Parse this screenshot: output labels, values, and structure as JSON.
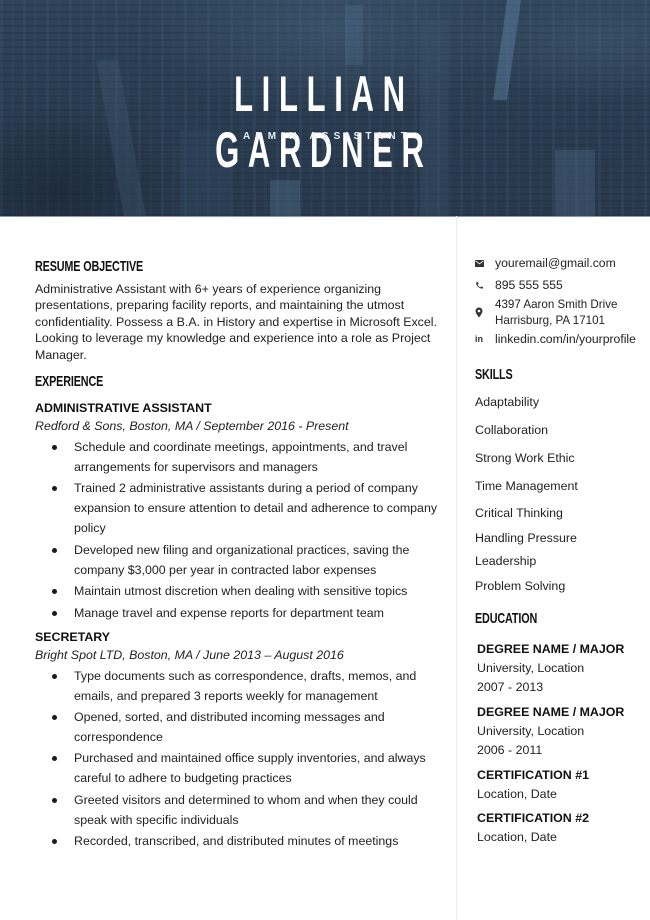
{
  "header": {
    "name": "LILLIAN GARDNER",
    "title": "ADMIN ASSISTANT",
    "background_color": "#2b3e53"
  },
  "objective": {
    "heading": "RESUME OBJECTIVE",
    "text": "Administrative Assistant with 6+ years of experience organizing presentations, preparing facility reports, and maintaining the utmost confidentiality.  Possess a B.A. in History and expertise in Microsoft Excel. Looking to leverage my knowledge and experience into a role as Project Manager."
  },
  "experience": {
    "heading": "EXPERIENCE",
    "jobs": [
      {
        "title": "ADMINISTRATIVE ASSISTANT",
        "meta": "Redford & Sons, Boston, MA  /  September 2016 - Present",
        "bullets": [
          "Schedule and coordinate meetings, appointments, and travel arrangements for supervisors and managers",
          "Trained 2 administrative assistants during a period of company expansion to ensure attention to detail and adherence to company policy",
          "Developed new filing and organizational practices, saving the company $3,000 per year in contracted labor expenses",
          "Maintain utmost discretion when dealing with sensitive topics",
          "Manage travel and expense reports for department team"
        ]
      },
      {
        "title": "SECRETARY",
        "meta": "Bright Spot LTD, Boston, MA  /  June 2013 – August 2016",
        "bullets": [
          "Type documents such as correspondence, drafts, memos, and emails, and prepared 3 reports weekly for management",
          "Opened, sorted, and distributed incoming messages and correspondence",
          "Purchased and maintained office supply inventories, and always careful to adhere to budgeting practices",
          "Greeted visitors and determined to whom and when they could speak with specific individuals",
          "Recorded, transcribed, and distributed minutes of meetings"
        ]
      }
    ]
  },
  "contact": {
    "email": {
      "icon": "envelope-icon",
      "value": "youremail@gmail.com"
    },
    "phone": {
      "icon": "phone-icon",
      "value": "895 555 555"
    },
    "address": {
      "icon": "map-pin-icon",
      "line1": "4397 Aaron Smith Drive",
      "line2": "Harrisburg, PA 17101"
    },
    "linkedin": {
      "icon": "linkedin-icon",
      "icon_text": "in",
      "value": "linkedin.com/in/yourprofile"
    }
  },
  "skills": {
    "heading": "SKILLS",
    "items": [
      "Adaptability",
      "Collaboration",
      "Strong Work Ethic",
      "Time Management",
      "Critical Thinking",
      "Handling Pressure",
      "Leadership",
      "Problem Solving"
    ]
  },
  "education": {
    "heading": "EDUCATION",
    "entries": [
      {
        "title": "DEGREE NAME / MAJOR",
        "line1": "University, Location",
        "line2": "2007 - 2013"
      },
      {
        "title": "DEGREE NAME / MAJOR",
        "line1": "University, Location",
        "line2": "2006 - 2011"
      },
      {
        "title": "CERTIFICATION #1",
        "line1": "Location, Date"
      },
      {
        "title": "CERTIFICATION #2",
        "line1": "Location, Date"
      }
    ]
  }
}
